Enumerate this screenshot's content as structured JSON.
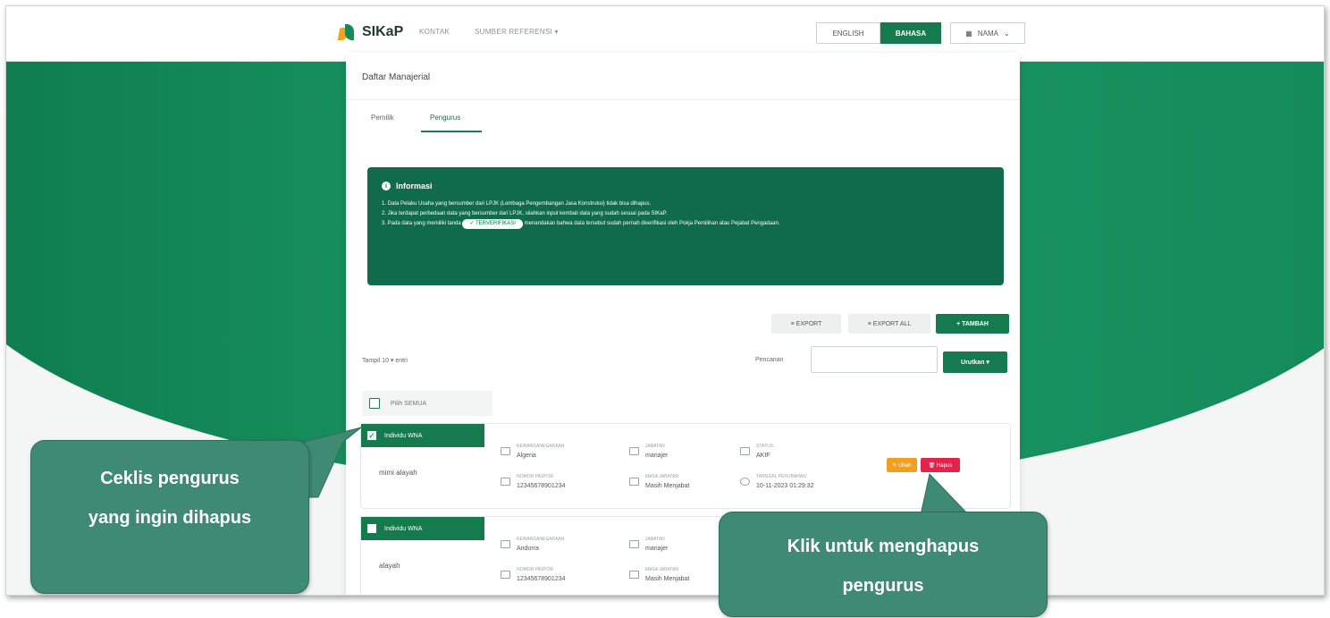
{
  "app": {
    "logo_text": "SIKaP",
    "nav_items": [
      "KONTAK",
      "SUMBER REFERENSI ▾"
    ]
  },
  "header": {
    "lang_en": "ENGLISH",
    "lang_id": "BAHASA",
    "user_label": "NAMA"
  },
  "page": {
    "title": "Daftar Manajerial",
    "tabs": [
      {
        "label": "Pemilik",
        "active": false
      },
      {
        "label": "Pengurus",
        "active": true
      }
    ]
  },
  "info": {
    "heading": "Informasi",
    "line1": "1. Data Pelaku Usaha yang bersumber dari LPJK (Lembaga Pengembangan Jasa Konstruksi) tidak bisa dihapus.",
    "line2": "2. Jika terdapat perbedaan data yang bersumber dari LPJK, silahkan input kembali data yang sudah sesuai pada SIKaP.",
    "line3_a": "3. Pada data yang memiliki tanda",
    "badge": "✓ TERVERIFIKASI",
    "line3_b": "menandakan bahwa data tersebut sudah pernah diverifikasi oleh Pokja Pemilihan atau Pejabat Pengadaan."
  },
  "toolbar": {
    "export": "≡ EXPORT",
    "export_all": "≡ EXPORT ALL",
    "add": "+ TAMBAH",
    "show_entries": "Tampil  10 ▾  entri",
    "search_label": "Pencarian",
    "sort": "Urutkan ▾",
    "select_all": "Pilih SEMUA"
  },
  "rows": [
    {
      "tag": "Individu WNA",
      "checked": true,
      "name": "mimi alayah",
      "f1_label": "KEWARGANEGARAAN",
      "f1_value": "Algeria",
      "f2_label": "JABATAN",
      "f2_value": "manajer",
      "f3_label": "STATUS",
      "f3_value": "AKIF",
      "f4_label": "NOMOR PASPOR",
      "f4_value": "12345678901234",
      "f5_label": "MASA JABATAN",
      "f5_value": "Masih Menjabat",
      "f6_label": "TANGGAL PERUBAHAN",
      "f6_value": "10-11-2023 01:29:32",
      "edit": "✎ Ubah",
      "delete": "🗑 Hapus"
    },
    {
      "tag": "Individu WNA",
      "checked": false,
      "name": "alayah",
      "f1_label": "KEWARGANEGARAAN",
      "f1_value": "Andorra",
      "f2_label": "JABATAN",
      "f2_value": "manajer",
      "f4_label": "NOMOR PASPOR",
      "f4_value": "12345678901234",
      "f5_label": "MASA JABATAN",
      "f5_value": "Masih Menjabat"
    }
  ],
  "callouts": {
    "left_line1": "Ceklis pengurus",
    "left_line2": "yang ingin dihapus",
    "right_line1": "Klik untuk menghapus",
    "right_line2": "pengurus"
  },
  "colors": {
    "primary": "#157a4d",
    "danger": "#e2234a",
    "warning": "#f0a021",
    "callout": "#3e8a72"
  }
}
